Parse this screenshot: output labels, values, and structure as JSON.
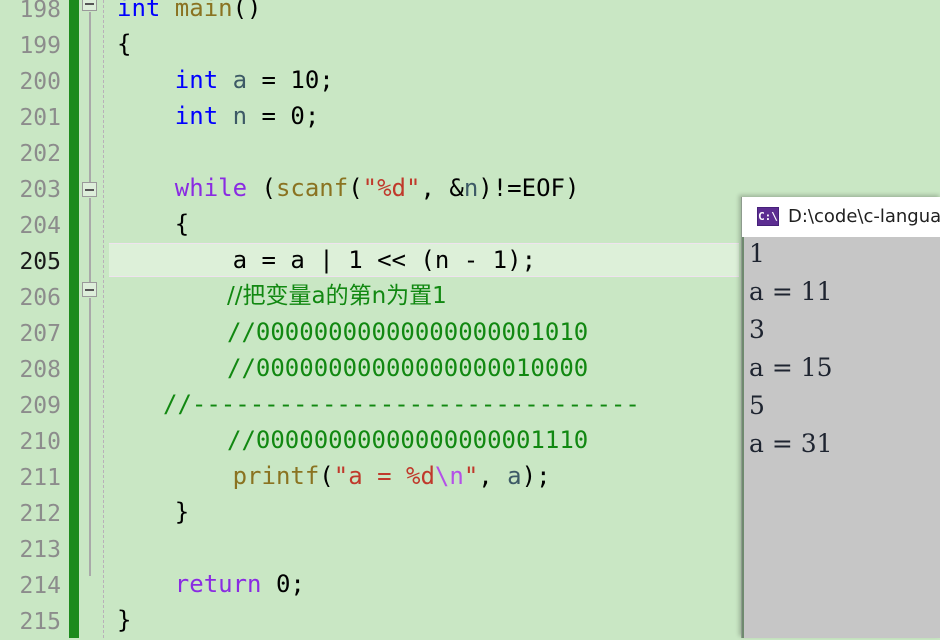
{
  "editor": {
    "background_color": "#c9e7c4",
    "highlight_color": "#ddf0d9",
    "modified_bar_color": "#1c8a1c",
    "lines": [
      {
        "num": "198",
        "active": false
      },
      {
        "num": "199",
        "active": false
      },
      {
        "num": "200",
        "active": false
      },
      {
        "num": "201",
        "active": false
      },
      {
        "num": "202",
        "active": false
      },
      {
        "num": "203",
        "active": false
      },
      {
        "num": "204",
        "active": false
      },
      {
        "num": "205",
        "active": true
      },
      {
        "num": "206",
        "active": false
      },
      {
        "num": "207",
        "active": false
      },
      {
        "num": "208",
        "active": false
      },
      {
        "num": "209",
        "active": false
      },
      {
        "num": "210",
        "active": false
      },
      {
        "num": "211",
        "active": false
      },
      {
        "num": "212",
        "active": false
      },
      {
        "num": "213",
        "active": false
      },
      {
        "num": "214",
        "active": false
      },
      {
        "num": "215",
        "active": false
      }
    ],
    "code": {
      "l198_int": "int",
      "l198_main": " main",
      "l198_parens": "()",
      "l199_brace": "{",
      "l200_int": "    int",
      "l200_var": " a",
      "l200_rest": " = 10;",
      "l201_int": "    int",
      "l201_var": " n",
      "l201_rest": " = 0;",
      "l203_while": "    while",
      "l203_open": " (",
      "l203_scanf": "scanf",
      "l203_paren2": "(",
      "l203_str": "\"%d\"",
      "l203_mid": ", &",
      "l203_var": "n",
      "l203_end": ")!=EOF)",
      "l204_brace": "    {",
      "l205_stmt": "        a = a | 1 << (n - 1);",
      "l206_comment": "//把变量a的第n为置1",
      "l207_comment": "//00000000000000000001010",
      "l208_comment": "//00000000000000000010000",
      "l209_comment": "//-------------------------------",
      "l210_comment": "//00000000000000000001110",
      "l211_printf": "        printf",
      "l211_paren": "(",
      "l211_str1": "\"a = %d",
      "l211_esc": "\\n",
      "l211_str2": "\"",
      "l211_mid": ", ",
      "l211_var": "a",
      "l211_end": ");",
      "l212_brace": "    }",
      "l214_return": "    return",
      "l214_rest": " 0;",
      "l215_brace": "}"
    }
  },
  "console": {
    "icon_label": "C:\\",
    "title": "D:\\code\\c-languag",
    "output_lines": [
      "1",
      "a = 11",
      "3",
      "a = 15",
      "5",
      "a = 31"
    ]
  }
}
